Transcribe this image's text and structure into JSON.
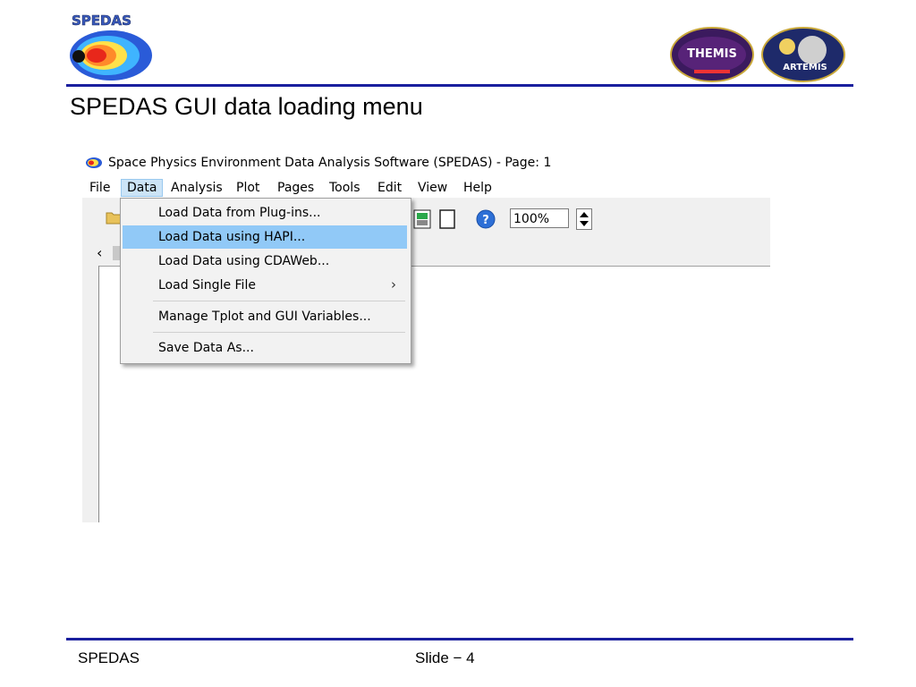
{
  "header": {
    "spedas_logo_text": "SPEDAS",
    "themis_logo_text": "THEMIS",
    "artemis_logo_text": "ARTEMIS"
  },
  "slide": {
    "title": "SPEDAS GUI data loading menu"
  },
  "window": {
    "title": "Space Physics Environment Data Analysis Software (SPEDAS) - Page: 1"
  },
  "menubar": {
    "items": [
      "File",
      "Data",
      "Analysis",
      "Plot",
      "Pages",
      "Tools",
      "Edit",
      "View",
      "Help"
    ],
    "active": "Data"
  },
  "toolbar": {
    "zoom_value": "100%",
    "help_icon": "question-icon"
  },
  "tabstrip": {
    "scroll_left": "‹"
  },
  "data_menu": {
    "items": [
      {
        "label": "Load Data from Plug-ins..."
      },
      {
        "label": "Load Data using HAPI..."
      },
      {
        "label": "Load Data using CDAWeb..."
      },
      {
        "label": "Load Single File"
      },
      {
        "label": "Manage Tplot and GUI Variables..."
      },
      {
        "label": "Save Data As..."
      }
    ],
    "highlighted_item": "Load Data using HAPI...",
    "submenu_arrow": "›"
  },
  "footer": {
    "left": "SPEDAS",
    "center": "Slide − 4"
  },
  "colors": {
    "rule": "#1a1f9e",
    "menu_highlight": "#91c9f7",
    "active_menu": "#cce4f7"
  }
}
